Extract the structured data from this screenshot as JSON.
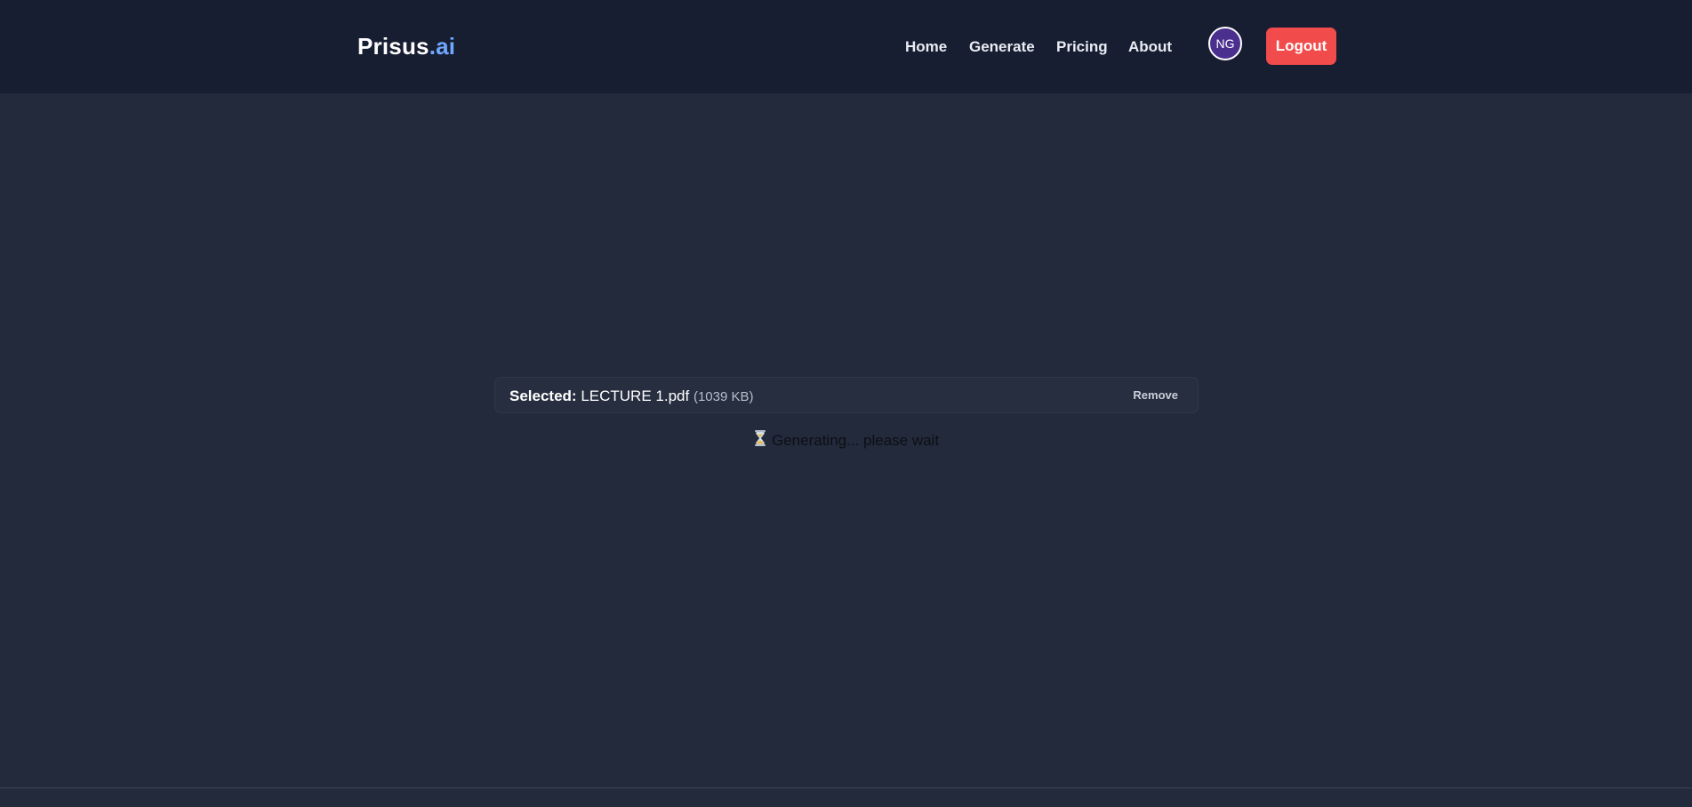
{
  "brand": {
    "name_main": "Prisus",
    "name_accent": ".ai"
  },
  "nav": {
    "items": [
      {
        "label": "Home"
      },
      {
        "label": "Generate"
      },
      {
        "label": "Pricing"
      },
      {
        "label": "About"
      }
    ],
    "avatar_initials": "NG",
    "logout_label": "Logout"
  },
  "upload": {
    "selected_label": "Selected:",
    "file_name": "LECTURE 1.pdf",
    "file_size": "(1039 KB)",
    "remove_label": "Remove"
  },
  "status": {
    "icon": "hourglass-icon",
    "text": "Generating... please wait"
  },
  "colors": {
    "navbar_bg": "#181e32",
    "page_bg": "#222a3b",
    "accent": "#6fa8ff",
    "logout_bg": "#f24b4b",
    "avatar_bg": "#4b2f8f"
  }
}
